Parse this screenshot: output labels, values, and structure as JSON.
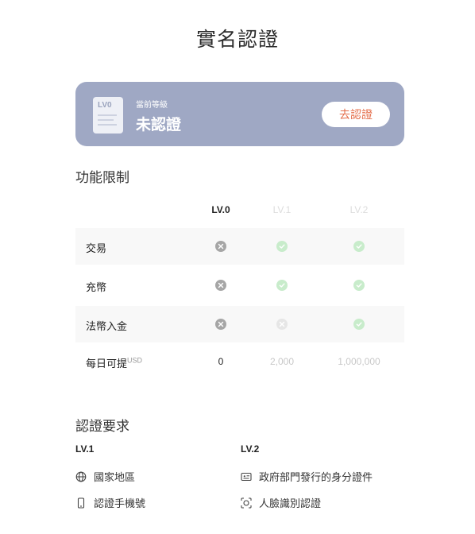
{
  "page": {
    "title": "實名認證"
  },
  "level_card": {
    "badge_text": "LV0",
    "caption": "當前等級",
    "value": "未認證",
    "button_label": "去認證"
  },
  "limits": {
    "title": "功能限制",
    "columns": [
      "LV.0",
      "LV.1",
      "LV.2"
    ],
    "rows": [
      {
        "label": "交易",
        "cells": [
          "x",
          "check",
          "check"
        ]
      },
      {
        "label": "充幣",
        "cells": [
          "x",
          "check",
          "check"
        ]
      },
      {
        "label": "法幣入金",
        "cells": [
          "x",
          "x-light",
          "check"
        ]
      },
      {
        "label": "每日可提",
        "unit": "USD",
        "cells": [
          "0",
          "2,000",
          "1,000,000"
        ]
      }
    ]
  },
  "requirements": {
    "title": "認證要求",
    "lv1": {
      "label": "LV.1",
      "items": [
        {
          "icon": "globe-icon",
          "text": "國家地區"
        },
        {
          "icon": "phone-icon",
          "text": "認證手機號"
        }
      ]
    },
    "lv2": {
      "label": "LV.2",
      "items": [
        {
          "icon": "id-card-icon",
          "text": "政府部門發行的身分證件"
        },
        {
          "icon": "face-scan-icon",
          "text": "人臉識別認證"
        }
      ]
    }
  },
  "colors": {
    "card_bg": "#9fa8c4",
    "button_text": "#e46d4a",
    "check_bg": "#c8eccb",
    "x_bg": "#a6a6a6"
  }
}
